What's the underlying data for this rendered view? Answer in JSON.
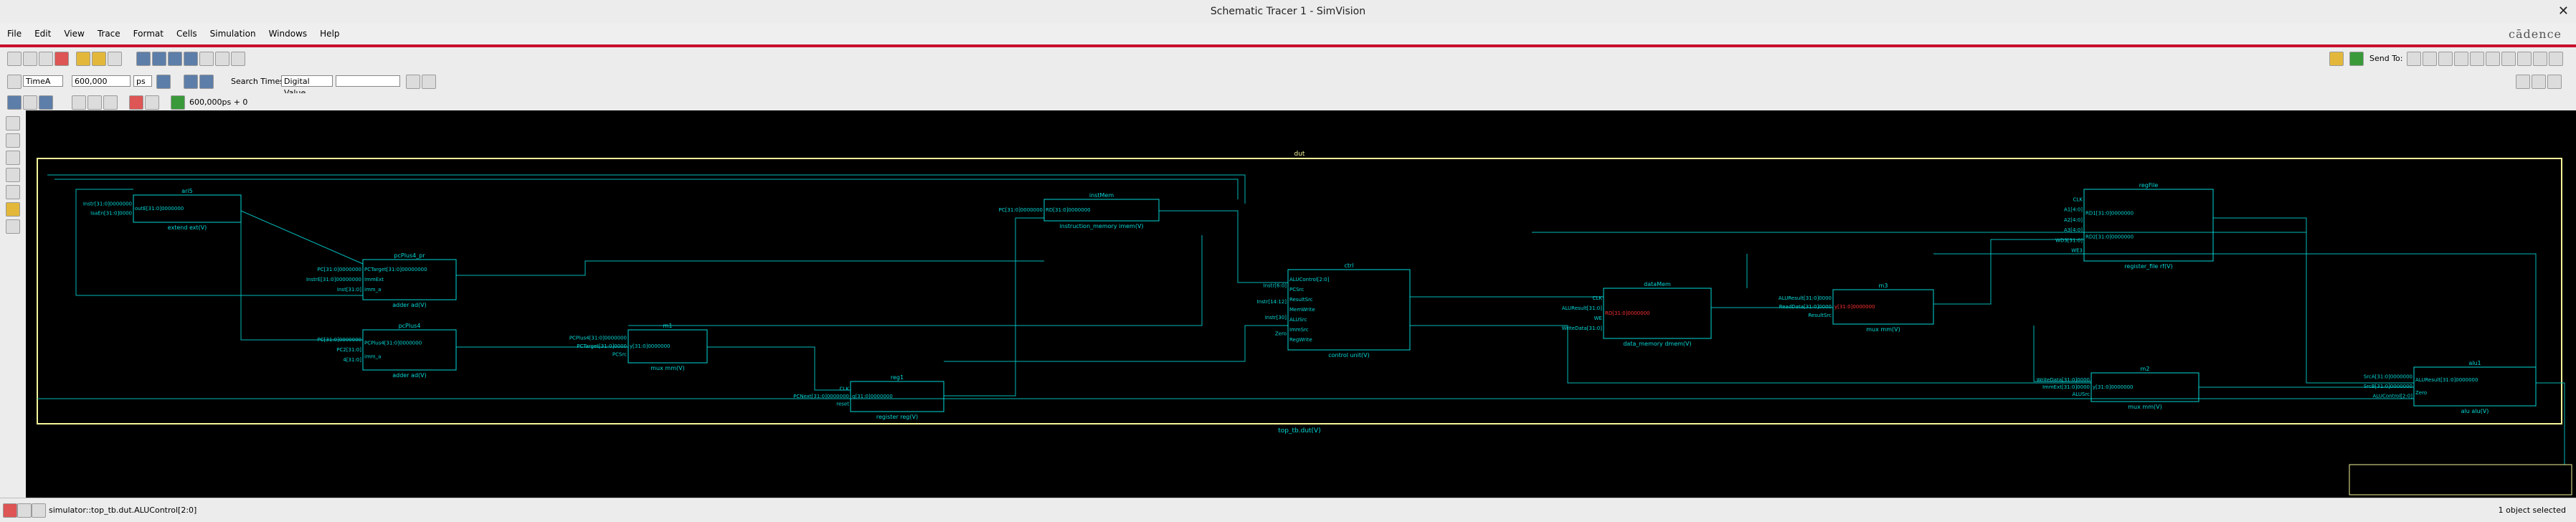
{
  "window": {
    "title": "Schematic Tracer 1 - SimVision",
    "close_glyph": "✕",
    "brand": "cādence"
  },
  "menu": [
    "File",
    "Edit",
    "View",
    "Trace",
    "Format",
    "Cells",
    "Simulation",
    "Windows",
    "Help"
  ],
  "toolbar": {
    "send_to_label": "Send To:",
    "cursor_select": "TimeA",
    "time_value": "600,000",
    "time_unit": "ps",
    "search_label": "Search Times:",
    "search_mode": "Digital Value",
    "search_value": "",
    "time_readout": "600,000ps + 0"
  },
  "schematic": {
    "top_label": "dut",
    "top_instance": "top_tb.dut(V)",
    "blocks": [
      {
        "name": "ari5",
        "ports_left": [
          "Instr[31:0]0000000",
          "IsaEn[31:0]0000"
        ],
        "ports_right": [
          "outE[31:0]0000000"
        ],
        "instance": "extend ext(V)"
      },
      {
        "name": "instMem",
        "ports_left": [
          "PC[31:0]0000000"
        ],
        "ports_right": [
          "RD[31:0]0000000"
        ],
        "instance": "instruction_memory imem(V)"
      },
      {
        "name": "pcPlus4_pr",
        "ports_left": [
          "PC[31:0]0000000",
          "InstrE[31:0]00000000",
          "Inst[31:0]"
        ],
        "ports_right": [
          "PCTarget[31:0]00000000",
          "ImmExt",
          "imm_a"
        ],
        "instance": "adder ad(V)"
      },
      {
        "name": "pcPlus4",
        "ports_left": [
          "PC[31:0]0000000",
          "PC2[31:0]",
          "4[31:0]"
        ],
        "ports_right": [
          "PCPlus4[31:0]0000000",
          "imm_a"
        ],
        "instance": "adder ad(V)"
      },
      {
        "name": "m1",
        "ports_left": [
          "PCPlus4[31:0]0000000",
          "PCTarget[31:0]0000",
          "PCSrc"
        ],
        "ports_right": [
          "y[31:0]0000000"
        ],
        "instance": "mux mm(V)"
      },
      {
        "name": "reg1",
        "ports_left": [
          "CLK",
          "PCNext[31:0]0000000",
          "reset"
        ],
        "ports_right": [
          "q[31:0]0000000"
        ],
        "instance": "register reg(V)"
      },
      {
        "name": "ctrl",
        "ports_left": [
          "Instr[6:0]",
          "Instr[14:12]",
          "Instr[30]",
          "Zero"
        ],
        "ports_right": [
          "ALUControl[2:0]",
          "PCSrc",
          "ResultSrc",
          "MemWrite",
          "ALUSrc",
          "ImmSrc",
          "RegWrite"
        ],
        "instance": "control unit(V)"
      },
      {
        "name": "dataMem",
        "ports_left": [
          "CLK",
          "ALUResult[31:0]",
          "WE",
          "WriteData[31:0]"
        ],
        "ports_right": [
          "RD[31:0]0000000"
        ],
        "instance": "data_memory dmem(V)"
      },
      {
        "name": "m3",
        "ports_left": [
          "ALUResult[31:0]0000",
          "ReadData[31:0]0000",
          "ResultSrc"
        ],
        "ports_right": [
          "y[31:0]0000000"
        ],
        "instance": "mux mm(V)"
      },
      {
        "name": "regFile",
        "ports_left": [
          "CLK",
          "A1[4:0]",
          "A2[4:0]",
          "A3[4:0]",
          "WD3[31:0]",
          "WE3"
        ],
        "ports_right": [
          "RD1[31:0]0000000",
          "RD2[31:0]0000000"
        ],
        "instance": "register_file rf(V)"
      },
      {
        "name": "m2",
        "ports_left": [
          "WriteData[31:0]0000",
          "ImmExt[31:0]0000",
          "ALUSrc"
        ],
        "ports_right": [
          "y[31:0]0000000"
        ],
        "instance": "mux mm(V)"
      },
      {
        "name": "alu1",
        "ports_left": [
          "SrcA[31:0]0000000",
          "SrcB[31:0]0000000",
          "ALUControl[2:0]"
        ],
        "ports_right": [
          "ALUResult[31:0]0000000",
          "Zero"
        ],
        "instance": "alu alu(V)"
      }
    ]
  },
  "status": {
    "text": "simulator::top_tb.dut.ALUControl[2:0]",
    "selection": "1 object selected"
  },
  "colors": {
    "canvas": "#000000",
    "wire": "#00d8d8",
    "top_box": "#f5f59a",
    "highlight": "#ff3030",
    "accent": "#c8102e"
  }
}
